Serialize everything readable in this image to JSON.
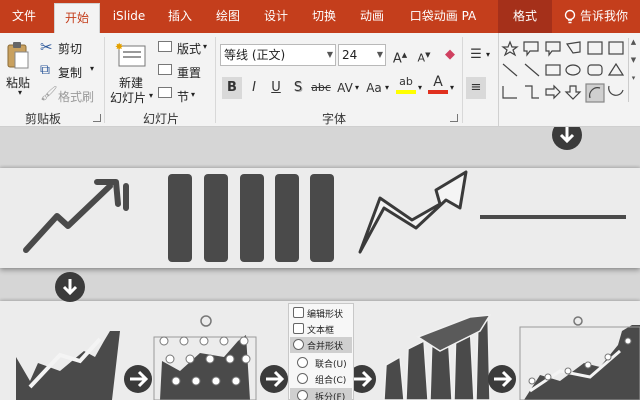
{
  "tabs": [
    {
      "label": "文件"
    },
    {
      "label": "开始"
    },
    {
      "label": "iSlide"
    },
    {
      "label": "插入"
    },
    {
      "label": "绘图"
    },
    {
      "label": "设计"
    },
    {
      "label": "切换"
    },
    {
      "label": "动画"
    },
    {
      "label": "口袋动画 PA"
    },
    {
      "label": "格式"
    },
    {
      "label": "告诉我你"
    }
  ],
  "clipboard": {
    "paste_label": "粘贴",
    "cut_label": "剪切",
    "copy_label": "复制",
    "format_painter_label": "格式刷",
    "group_label": "剪贴板"
  },
  "slides": {
    "new_slide_line1": "新建",
    "new_slide_line2": "幻灯片",
    "layout_label": "版式",
    "reset_label": "重置",
    "section_label": "节",
    "group_label": "幻灯片"
  },
  "font": {
    "name": "等线 (正文)",
    "size": "24",
    "group_label": "字体",
    "bold": "B",
    "italic": "I",
    "underline": "U",
    "shadow": "S",
    "strike": "abc",
    "spacing": "AV",
    "case": "Aa",
    "grow": "A",
    "shrink": "A",
    "color_a": "A",
    "highlight": "ab"
  },
  "merge_menu": {
    "edit_shape": "编辑形状",
    "textbox": "文本框",
    "merge_shapes": "合并形状",
    "union": "联合(U)",
    "combine": "组合(C)",
    "fragment": "拆分(F)"
  },
  "colors": {
    "tab_bar": "#c43e1c",
    "icon_dark": "#4a4a4a"
  }
}
